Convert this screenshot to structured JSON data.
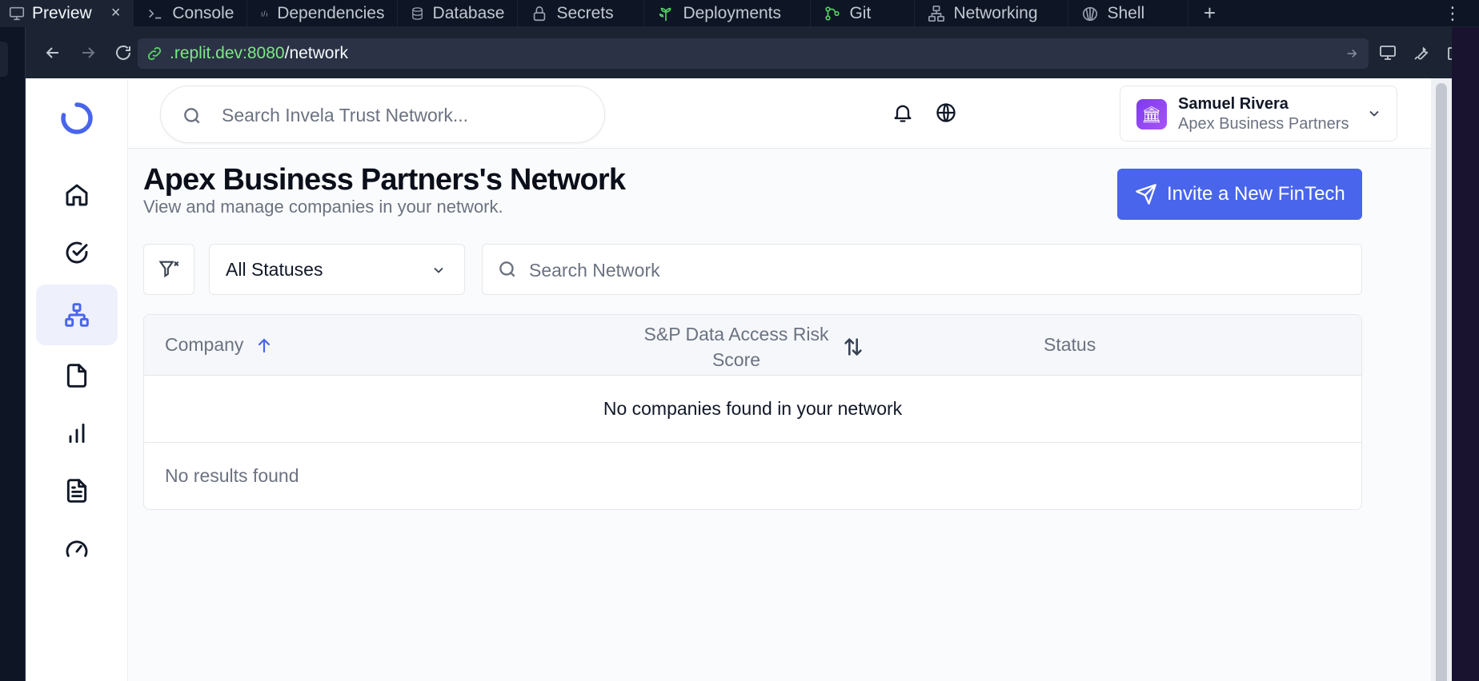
{
  "ide": {
    "tabs": [
      {
        "label": "Preview",
        "icon": "monitor-icon"
      },
      {
        "label": "Console",
        "icon": "terminal-icon"
      },
      {
        "label": "Dependencies",
        "icon": "dependencies-icon"
      },
      {
        "label": "Database",
        "icon": "database-icon"
      },
      {
        "label": "Secrets",
        "icon": "lock-icon"
      },
      {
        "label": "Deployments",
        "icon": "deployments-icon"
      },
      {
        "label": "Git",
        "icon": "git-icon"
      },
      {
        "label": "Networking",
        "icon": "networking-icon"
      },
      {
        "label": "Shell",
        "icon": "shell-icon"
      }
    ],
    "close_glyph": "×",
    "new_tab_glyph": "+",
    "more_glyph": "⋮",
    "url_host": ".replit.dev:8080",
    "url_path": "/network"
  },
  "header": {
    "search_placeholder": "Search Invela Trust Network...",
    "user_name": "Samuel Rivera",
    "user_org": "Apex Business Partners",
    "avatar_glyph": "🏛"
  },
  "sidebar": {
    "items": [
      {
        "icon": "home-icon"
      },
      {
        "icon": "check-circle-icon"
      },
      {
        "icon": "network-icon",
        "active": true
      },
      {
        "icon": "file-icon"
      },
      {
        "icon": "bar-chart-icon"
      },
      {
        "icon": "document-icon"
      },
      {
        "icon": "gauge-icon"
      }
    ]
  },
  "page": {
    "title": "Apex Business Partners's Network",
    "subtitle": "View and manage companies in your network.",
    "invite_label": "Invite a New FinTech",
    "status_filter": "All Statuses",
    "search_placeholder": "Search Network"
  },
  "table": {
    "columns": {
      "company": "Company",
      "risk": "S&P Data Access Risk Score",
      "status": "Status"
    },
    "empty_message": "No companies found in your network",
    "results_message": "No results found"
  },
  "colors": {
    "accent": "#4965ec",
    "url_host": "#7ee787",
    "ide_bg": "#0e1525"
  }
}
